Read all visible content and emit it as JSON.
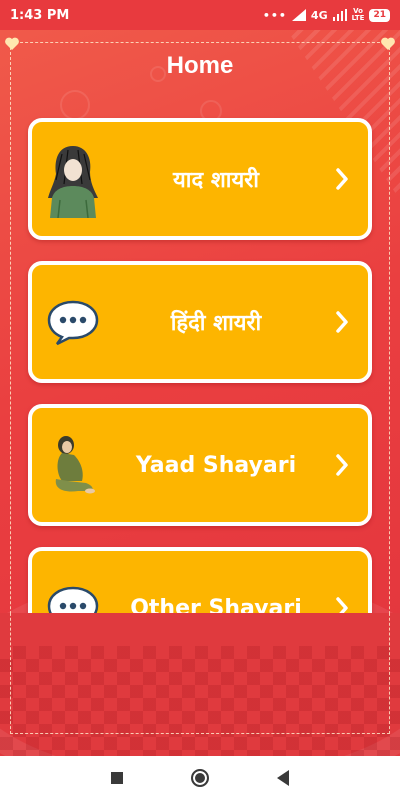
{
  "status": {
    "time": "1:43 PM",
    "dots": "•••",
    "network": "4G",
    "volte_line1": "Vo",
    "volte_line2": "LTE",
    "battery": "21"
  },
  "header": {
    "title": "Home"
  },
  "cards": [
    {
      "label": "याद शायरी",
      "icon": "sad-girl-sketch-icon"
    },
    {
      "label": "हिंदी शायरी",
      "icon": "speech-bubble-icon"
    },
    {
      "label": "Yaad Shayari",
      "icon": "sitting-girl-icon"
    },
    {
      "label": "Other Shayari",
      "icon": "speech-bubble-icon"
    }
  ],
  "colors": {
    "background_red": "#ea3f40",
    "card_yellow": "#fdb500",
    "card_border": "#ffffff",
    "text_white": "#ffffff"
  },
  "nav": {
    "icons": [
      "recent-apps-icon",
      "home-icon",
      "back-icon"
    ]
  }
}
